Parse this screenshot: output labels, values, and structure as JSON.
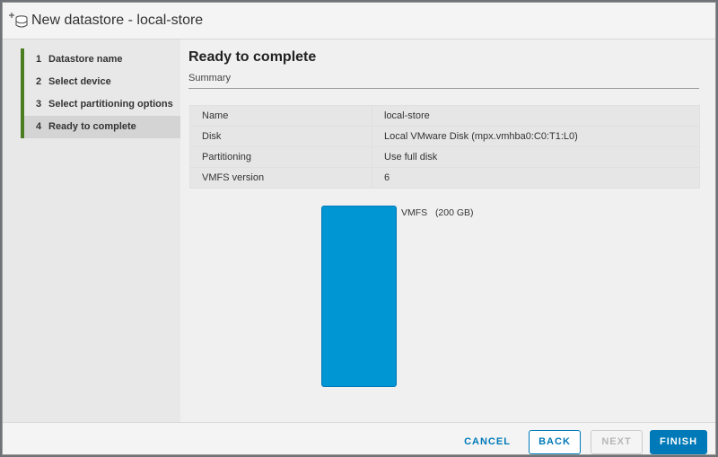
{
  "window": {
    "title": "New datastore - local-store",
    "icon": "datastore-add-icon"
  },
  "steps": [
    {
      "num": "1",
      "label": "Datastore name"
    },
    {
      "num": "2",
      "label": "Select device"
    },
    {
      "num": "3",
      "label": "Select partitioning options"
    },
    {
      "num": "4",
      "label": "Ready to complete",
      "active": true
    }
  ],
  "main": {
    "title": "Ready to complete",
    "section": "Summary",
    "rows": [
      {
        "key": "Name",
        "value": "local-store"
      },
      {
        "key": "Disk",
        "value": "Local VMware Disk (mpx.vmhba0:C0:T1:L0)"
      },
      {
        "key": "Partitioning",
        "value": "Use full disk"
      },
      {
        "key": "VMFS version",
        "value": "6"
      }
    ],
    "partition": {
      "label": "VMFS",
      "size": "(200 GB)",
      "color": "#0095d3"
    }
  },
  "footer": {
    "cancel": "CANCEL",
    "back": "BACK",
    "next": "NEXT",
    "finish": "FINISH"
  },
  "colors": {
    "step_accent": "#4a7e21",
    "primary": "#0079b8"
  }
}
